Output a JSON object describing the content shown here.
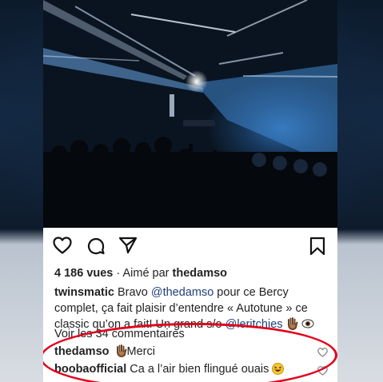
{
  "post": {
    "stats": {
      "views": "4 186 vues",
      "separator": " · ",
      "liked_by_prefix": "Aimé par ",
      "liked_by_user": "thedamso"
    },
    "caption": {
      "author": "twinsmatic",
      "text_1": " Bravo ",
      "mention_1": "@thedamso",
      "text_2": " pour ce Bercy complet, ça fait plaisir d’entendre « Autotune » ce classic qu’on a fait! Un grand s/o ",
      "mention_2": "@leritchies",
      "emoji_1": "raised-hand-emoji",
      "emoji_2": "eye-emoji"
    },
    "view_all_comments": "Voir les 34 commentaires",
    "comments": [
      {
        "user": "thedamso",
        "emoji": "raised-hand-emoji",
        "text": "Merci"
      },
      {
        "user": "boobaofficial",
        "text": "Ca a l’air bien flingué ouais",
        "emoji": "laughing-emoji"
      }
    ]
  },
  "icons": {
    "like": "heart-icon",
    "comment": "comment-icon",
    "share": "send-icon",
    "save": "bookmark-icon"
  },
  "colors": {
    "highlight_ellipse": "#e1001b",
    "mention": "#1e3f7a",
    "muted": "#8e8e8e"
  }
}
